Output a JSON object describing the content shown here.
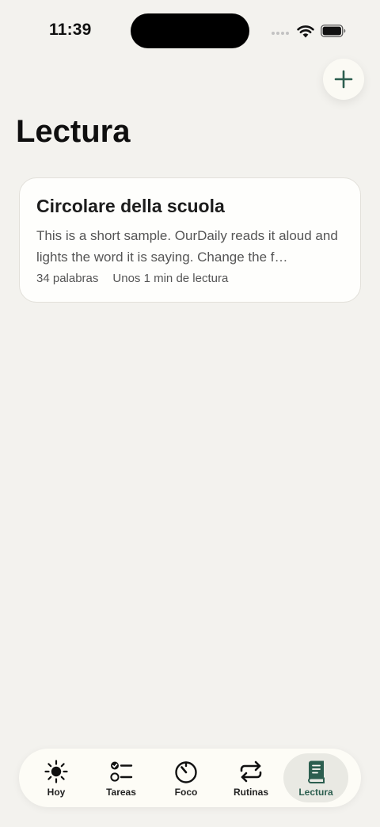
{
  "status_bar": {
    "time": "11:39"
  },
  "page": {
    "title": "Lectura"
  },
  "colors": {
    "background": "#f3f2ee",
    "accent": "#2c5e4f",
    "card": "#fefefc"
  },
  "add_button": {
    "icon": "plus-icon"
  },
  "readings": [
    {
      "title": "Circolare della scuola",
      "excerpt": "This is a short sample. OurDaily reads it aloud and lights the word it is saying. Change the f…",
      "word_count": "34 palabras",
      "read_time": "Unos 1 min de lectura"
    }
  ],
  "tabbar": {
    "items": [
      {
        "label": "Hoy",
        "icon": "sun-icon",
        "active": false
      },
      {
        "label": "Tareas",
        "icon": "checklist-icon",
        "active": false
      },
      {
        "label": "Foco",
        "icon": "timer-icon",
        "active": false
      },
      {
        "label": "Rutinas",
        "icon": "repeat-icon",
        "active": false
      },
      {
        "label": "Lectura",
        "icon": "book-icon",
        "active": true
      }
    ]
  }
}
